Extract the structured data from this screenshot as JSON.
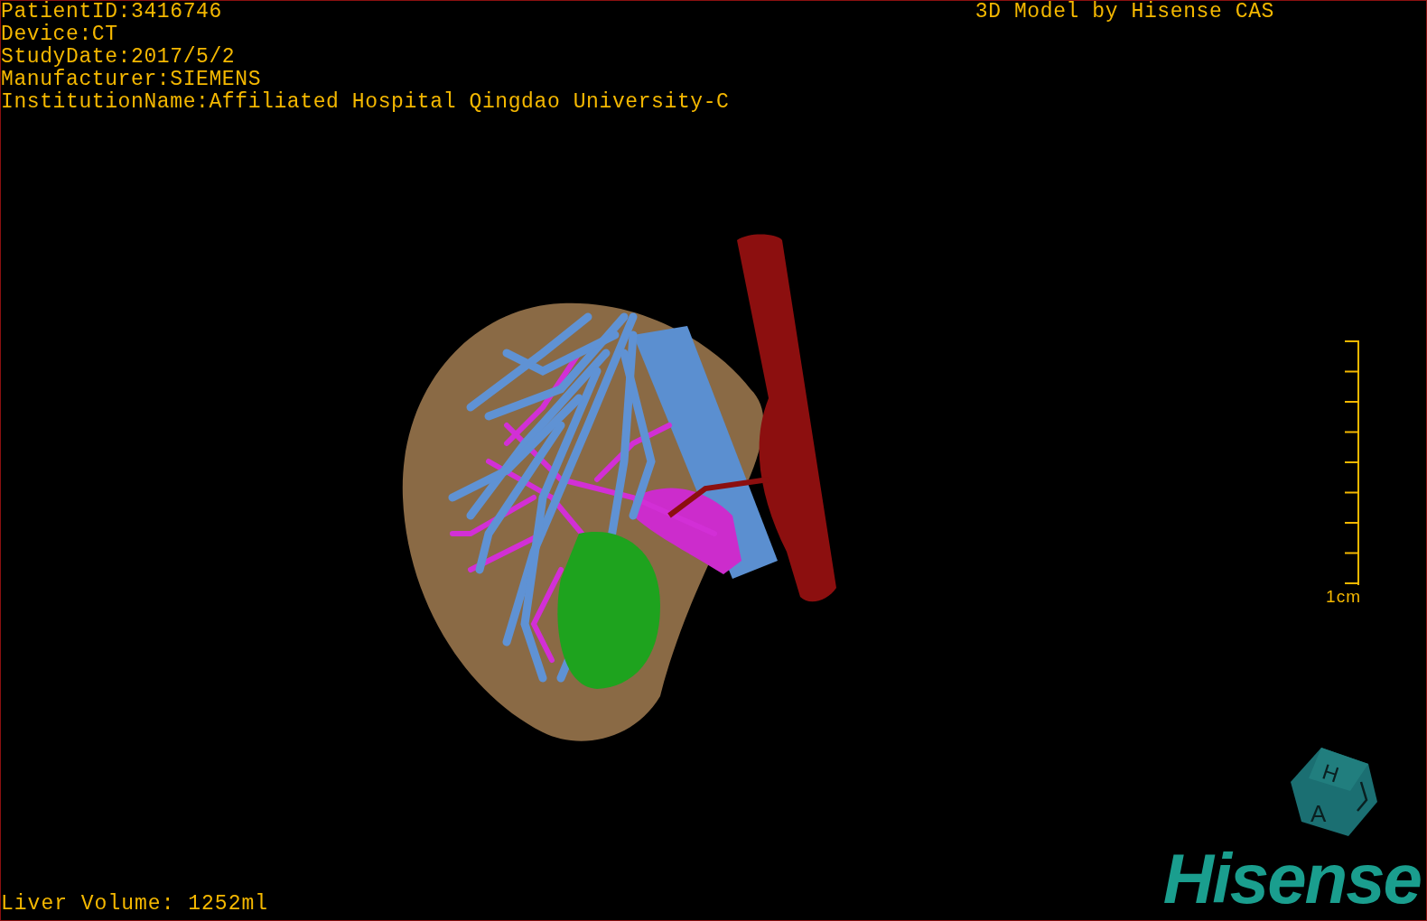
{
  "study_info": [
    "PatientID:3416746",
    "Device:CT",
    "StudyDate:2017/5/2",
    "Manufacturer:SIEMENS",
    "InstitutionName:Affiliated Hospital Qingdao University-C"
  ],
  "credit": "3D Model by Hisense CAS",
  "scale_bar": {
    "label": "1cm"
  },
  "orientation_cube": {
    "faces": [
      "H",
      "A"
    ]
  },
  "liver_volume": "Liver Volume: 1252ml",
  "logo": "Hisense"
}
